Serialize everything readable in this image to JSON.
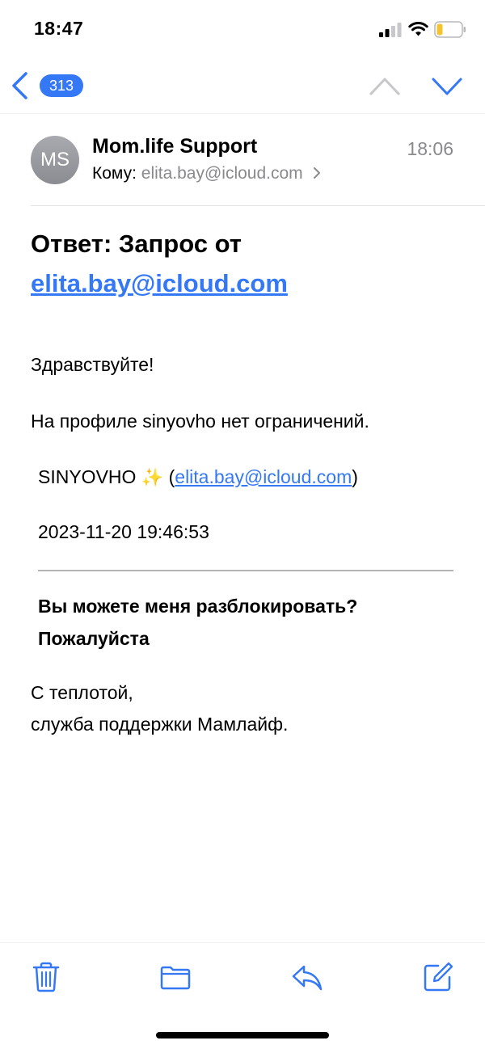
{
  "status_bar": {
    "time": "18:47"
  },
  "nav": {
    "unread_count": "313"
  },
  "message": {
    "avatar_initials": "MS",
    "sender": "Mom.life Support",
    "time": "18:06",
    "to_label": "Кому:",
    "to_address": "elita.bay@icloud.com",
    "subject_prefix": "Ответ: Запрос от",
    "subject_link": "elita.bay@icloud.com",
    "greeting": "Здравствуйте!",
    "profile_note": "На профиле sinyovho нет ограничений.",
    "quoted_name": "SINYOVHO",
    "quoted_email": "elita.bay@icloud.com",
    "quoted_date": "2023-11-20 19:46:53",
    "quoted_question": "Вы можете меня разблокировать? Пожалуйста",
    "signoff_line1": "С теплотой,",
    "signoff_line2": "служба поддержки Мамлайф."
  },
  "icons": {
    "back": "chevron-left-icon",
    "up": "chevron-up-icon",
    "down": "chevron-down-icon",
    "trash": "trash-icon",
    "folder": "folder-icon",
    "reply": "reply-icon",
    "compose": "compose-icon"
  },
  "colors": {
    "accent": "#3478f6",
    "secondary_text": "#8a8a8e"
  }
}
